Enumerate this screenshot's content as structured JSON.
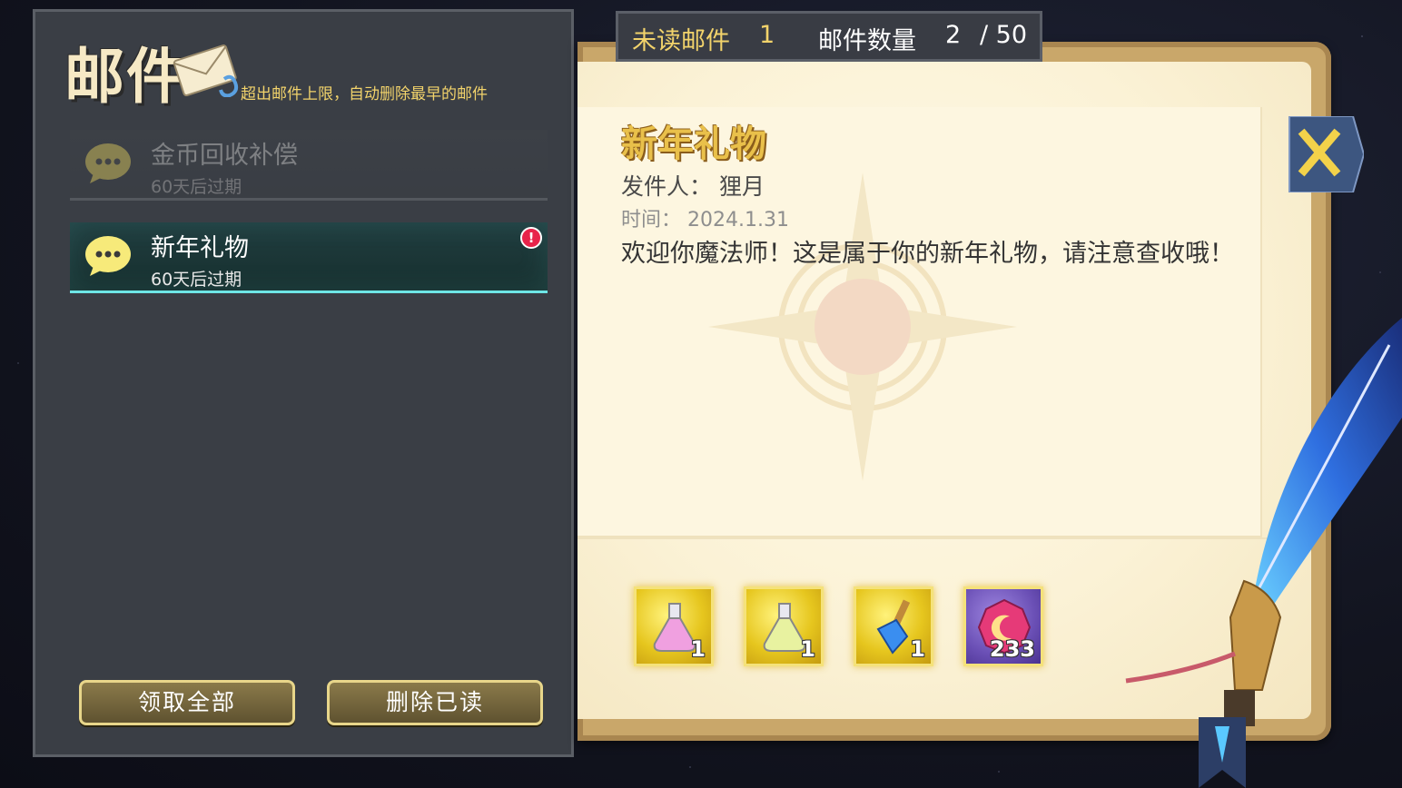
{
  "panel": {
    "title": "邮件",
    "hint": "超出邮件上限，自动删除最早的邮件"
  },
  "mail_list": [
    {
      "subject": "金币回收补偿",
      "expire": "60天后过期",
      "state": "read"
    },
    {
      "subject": "新年礼物",
      "expire": "60天后过期",
      "state": "unread",
      "badge": "!"
    }
  ],
  "buttons": {
    "claim_all": "领取全部",
    "delete_read": "删除已读"
  },
  "counter": {
    "unread_label": "未读邮件",
    "unread_value": "1",
    "count_label": "邮件数量",
    "count_value": "2",
    "count_max": "/ 50"
  },
  "letter": {
    "title": "新年礼物",
    "sender": "发件人： 狸月",
    "time": "时间： 2024.1.31",
    "body": "欢迎你魔法师！这是属于你的新年礼物，请注意查收哦！"
  },
  "rewards": [
    {
      "icon": "pink-potion-icon",
      "qty": "1",
      "frame": "gold"
    },
    {
      "icon": "green-potion-icon",
      "qty": "1",
      "frame": "gold"
    },
    {
      "icon": "blue-crystal-icon",
      "qty": "1",
      "frame": "gold"
    },
    {
      "icon": "moon-gem-icon",
      "qty": "233",
      "frame": "purple"
    }
  ],
  "colors": {
    "accent_gold": "#f2d36b",
    "active_border": "#6ee6e6",
    "alert": "#e8234a",
    "paper": "#fdf6e0"
  }
}
